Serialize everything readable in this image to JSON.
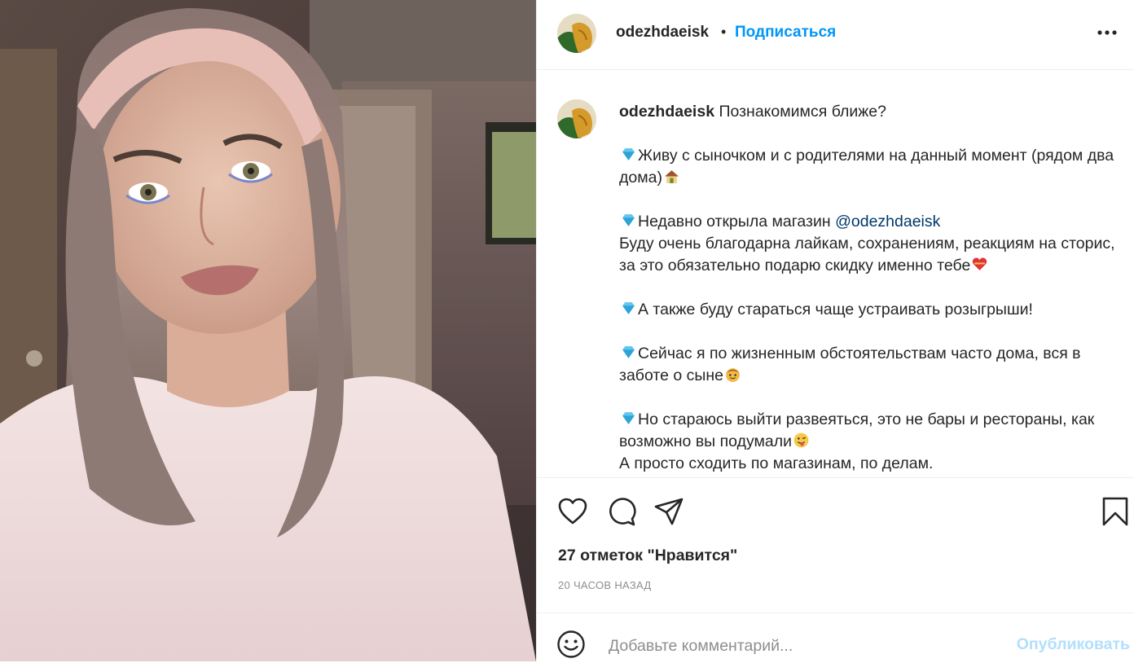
{
  "post": {
    "author": "odezhdaeisk",
    "separator": "•",
    "follow_label": "Подписаться",
    "more_icon": "more-horizontal-icon"
  },
  "caption": {
    "author": "odezhdaeisk",
    "intro": "Познакомимся ближе?",
    "p1": "Живу с сыночком и с родителями на данный момент (рядом два дома)",
    "p2_text": "Недавно открыла магазин ",
    "p2_mention": "@odezhdaeisk",
    "p2_rest": "Буду очень благодарна лайкам, сохранениям, реакциям на сторис, за это обязательно подарю скидку именно тебе",
    "p3": "А также буду стараться чаще устраивать розыгрыши!",
    "p4": "Сейчас я по жизненным обстоятельствам часто дома, вся в заботе о сыне",
    "p5": "Но стараюсь выйти развеяться, это не бары и рестораны, как возможно вы подумали",
    "p5_rest": "А просто сходить по магазинам, по делам."
  },
  "actions": {
    "like_icon": "heart-icon",
    "comment_icon": "comment-icon",
    "share_icon": "share-icon",
    "save_icon": "bookmark-icon"
  },
  "likes_text": "27 отметок \"Нравится\"",
  "time_ago": "20 часов назад",
  "comment": {
    "placeholder": "Добавьте комментарий...",
    "publish_label": "Опубликовать"
  },
  "colors": {
    "link_blue": "#0095f6",
    "publish_disabled": "#b2dffc",
    "mention": "#00376b",
    "text": "#262626",
    "muted": "#8e8e8e"
  }
}
